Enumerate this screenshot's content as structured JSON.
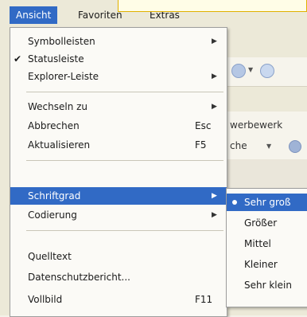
{
  "menubar": {
    "items": [
      {
        "label": "Ansicht",
        "active": true
      },
      {
        "label": "Favoriten",
        "active": false
      },
      {
        "label": "Extras",
        "active": false
      }
    ]
  },
  "background": {
    "address_text": "werbewerk",
    "search_label": "che"
  },
  "menu": {
    "items": [
      {
        "label": "Symbolleisten",
        "submenu": true
      },
      {
        "label": "Statusleiste",
        "checked": true
      },
      {
        "label": "Explorer-Leiste",
        "submenu": true
      },
      {
        "label": "Wechseln zu",
        "submenu": true
      },
      {
        "label": "Abbrechen",
        "shortcut": "Esc"
      },
      {
        "label": "Aktualisieren",
        "shortcut": "F5"
      },
      {
        "label": "Schriftgrad",
        "submenu": true,
        "highlight": true
      },
      {
        "label": "Codierung",
        "submenu": true
      },
      {
        "label": "Quelltext"
      },
      {
        "label": "Datenschutzbericht..."
      },
      {
        "label": "Vollbild",
        "shortcut": "F11"
      }
    ]
  },
  "submenu": {
    "items": [
      {
        "label": "Sehr groß",
        "selected": true
      },
      {
        "label": "Größer"
      },
      {
        "label": "Mittel"
      },
      {
        "label": "Kleiner"
      },
      {
        "label": "Sehr klein"
      }
    ]
  },
  "colors": {
    "highlight": "#316ac5",
    "menu_bg": "#fbfaf6"
  },
  "icons": {
    "check": "checkmark-icon",
    "submenu_arrow": "triangle-right-icon",
    "radio_dot": "radio-dot-icon"
  }
}
